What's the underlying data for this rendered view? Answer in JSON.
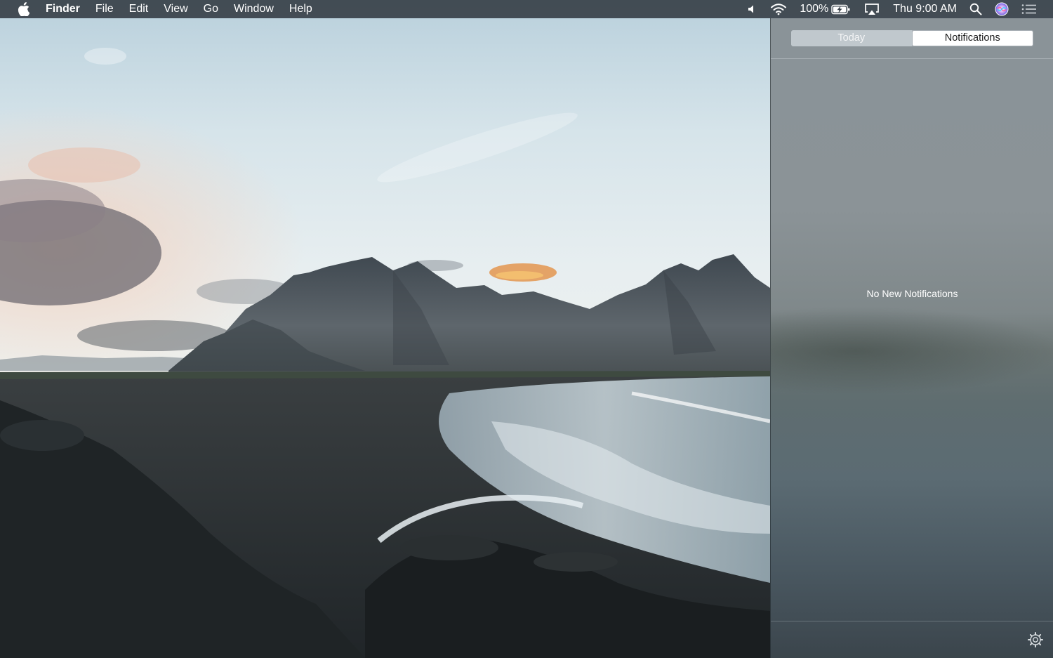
{
  "menubar": {
    "apple_icon": "apple-logo-icon",
    "app_name": "Finder",
    "menus": [
      "File",
      "Edit",
      "View",
      "Go",
      "Window",
      "Help"
    ],
    "status": {
      "volume_icon": "speaker-icon",
      "wifi_icon": "wifi-icon",
      "battery_percent": "100%",
      "battery_icon": "battery-charging-icon",
      "airplay_icon": "airplay-icon",
      "clock": "Thu 9:00 AM",
      "spotlight_icon": "search-icon",
      "siri_icon": "siri-icon",
      "notification_center_icon": "list-icon"
    }
  },
  "notification_center": {
    "tabs": [
      {
        "label": "Today",
        "selected": false
      },
      {
        "label": "Notifications",
        "selected": true
      }
    ],
    "empty_message": "No New Notifications",
    "settings_icon": "gear-icon"
  },
  "colors": {
    "menubar_bg": "#2e363e",
    "sky_top": "#c9dbe4",
    "mountain": "#4e575f",
    "sand": "#2b3034"
  }
}
